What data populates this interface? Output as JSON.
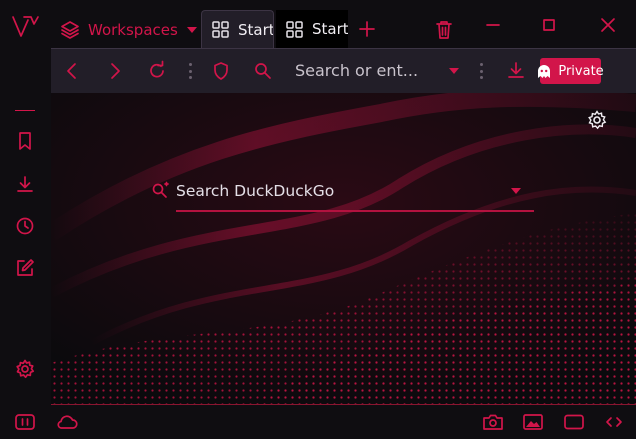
{
  "colors": {
    "accent": "#d2154a",
    "toolbar_bg": "#221e28",
    "window_bg": "#0f0d11"
  },
  "titlebar": {
    "logo_icon": "vivaldi-logo",
    "workspaces_label": "Workspaces",
    "tabs": [
      {
        "label": "Start",
        "icon": "grid-icon",
        "active": true
      },
      {
        "label": "Start",
        "icon": "grid-icon",
        "active": false
      }
    ],
    "icons": [
      "layers-icon",
      "chevron-down-icon",
      "plus-icon",
      "trash-icon",
      "minimize-icon",
      "maximize-icon",
      "close-icon"
    ]
  },
  "toolbar": {
    "address_placeholder": "Search or ent...",
    "private_label": "Private",
    "icons": [
      "back-icon",
      "forward-icon",
      "reload-icon",
      "shield-icon",
      "search-icon",
      "download-icon",
      "ghost-icon"
    ]
  },
  "sidebar": {
    "icons": [
      "bookmark-icon",
      "download-icon",
      "clock-icon",
      "notes-icon",
      "gear-icon"
    ]
  },
  "start_page": {
    "search_placeholder": "Search DuckDuckGo",
    "search_engine": "DuckDuckGo",
    "icons": [
      "gear-icon",
      "search-engine-icon",
      "chevron-down-icon"
    ]
  },
  "statusbar": {
    "icons": [
      "panel-toggle-icon",
      "cloud-icon",
      "camera-icon",
      "image-icon",
      "window-icon",
      "code-icon"
    ]
  }
}
